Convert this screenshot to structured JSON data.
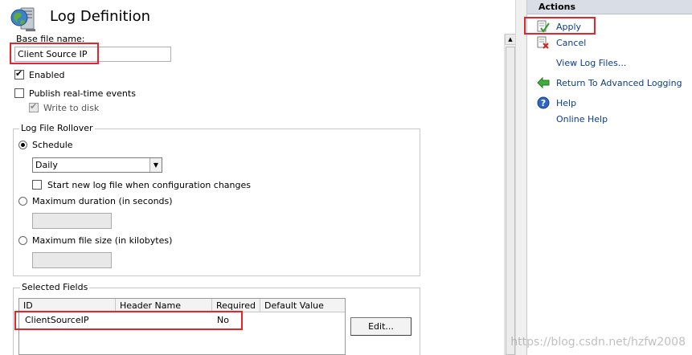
{
  "page": {
    "title": "Log Definition",
    "base_file_label": "Base file name:",
    "base_file_value": "Client Source IP",
    "enabled_label": "Enabled",
    "publish_label": "Publish real-time events",
    "write_to_disk_label": "Write to disk"
  },
  "rollover": {
    "group_title": "Log File Rollover",
    "schedule_label": "Schedule",
    "schedule_value": "Daily",
    "start_new_label": "Start new log file when configuration changes",
    "max_duration_label": "Maximum duration (in seconds)",
    "max_size_label": "Maximum file size (in kilobytes)"
  },
  "fields": {
    "group_title": "Selected Fields",
    "columns": [
      "ID",
      "Header Name",
      "Required",
      "Default Value"
    ],
    "rows": [
      {
        "id": "ClientSourceIP",
        "header_name": "",
        "required": "No",
        "default_value": ""
      }
    ],
    "edit_label": "Edit..."
  },
  "actions": {
    "header": "Actions",
    "apply": "Apply",
    "cancel": "Cancel",
    "view_log_files": "View Log Files...",
    "return": "Return To Advanced Logging",
    "help": "Help",
    "online_help": "Online Help"
  },
  "watermark": "https://blog.csdn.net/hzfw2008",
  "colors": {
    "annotation_red": "#e8242a",
    "link_blue": "#0a3d8a",
    "actions_header_bg": "#d9dee6"
  }
}
